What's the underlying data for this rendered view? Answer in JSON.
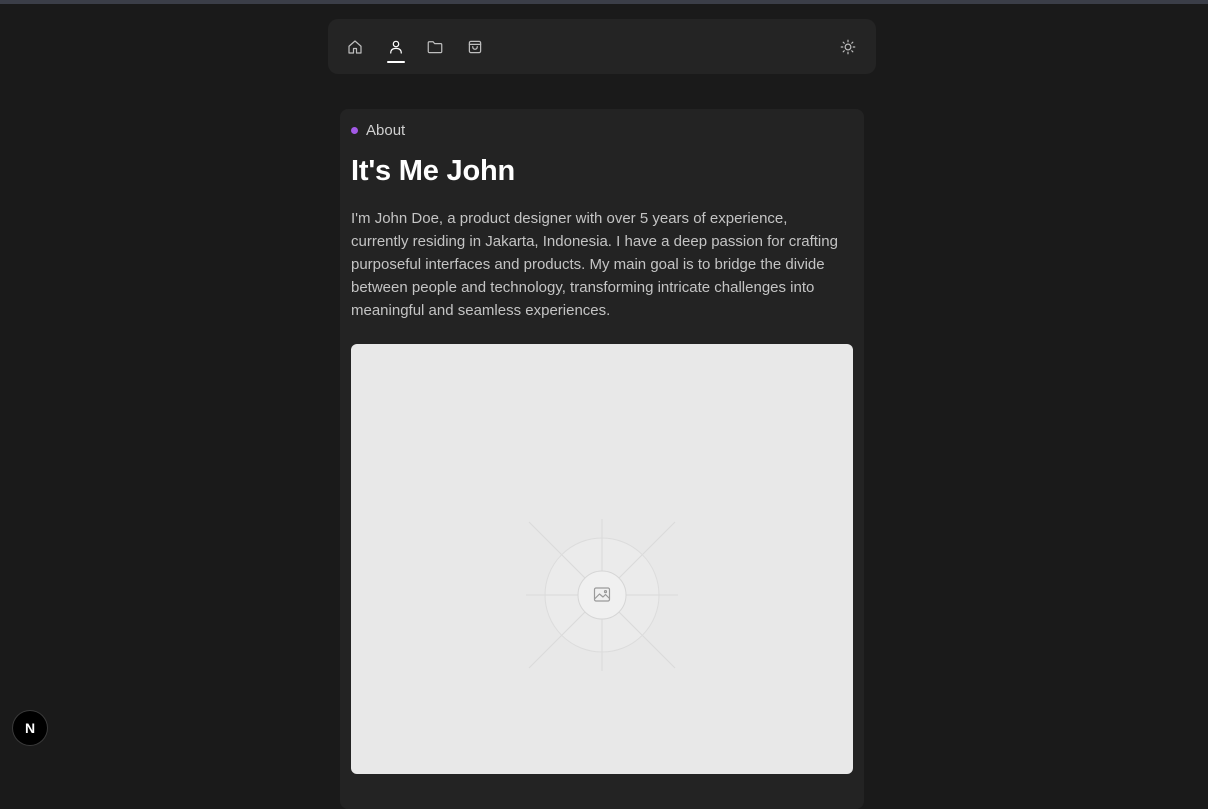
{
  "nav": {
    "items": [
      {
        "icon": "home-icon"
      },
      {
        "icon": "user-icon",
        "active": true
      },
      {
        "icon": "folder-icon"
      },
      {
        "icon": "shopping-bag-icon"
      }
    ],
    "theme_toggle_icon": "sun-icon"
  },
  "about": {
    "section_label": "About",
    "section_dot_color": "#a259e6",
    "title": "It's Me John",
    "bio": "I'm John Doe, a product designer with over 5 years of experience, currently residing in Jakarta, Indonesia. I have a deep passion for crafting purposeful interfaces and products. My main goal is to bridge the divide between people and technology, transforming intricate challenges into meaningful and seamless experiences."
  },
  "image": {
    "placeholder_icon": "image-icon"
  },
  "badge": {
    "letter": "N"
  },
  "colors": {
    "background": "#1a1a1a",
    "card": "#232323",
    "navbar": "#242424",
    "placeholder": "#e8e8e8"
  }
}
